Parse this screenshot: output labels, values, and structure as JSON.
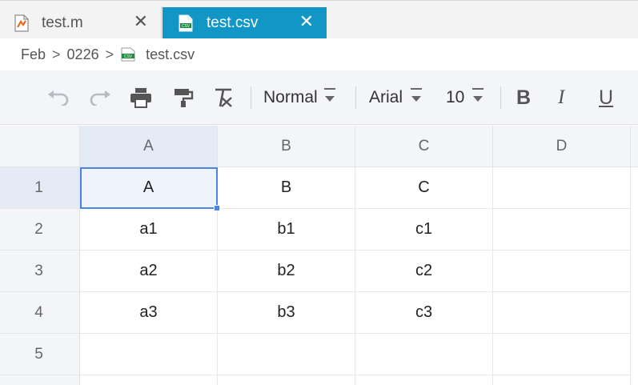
{
  "tabs": [
    {
      "label": "test.m",
      "icon": "matlab-file-icon",
      "active": false
    },
    {
      "label": "test.csv",
      "icon": "csv-file-icon",
      "active": true
    }
  ],
  "tab_close_glyph": "✕",
  "breadcrumb": {
    "items": [
      "Feb",
      "0226",
      "test.csv"
    ],
    "separator": ">"
  },
  "toolbar": {
    "style_dropdown": "Normal",
    "font_dropdown": "Arial",
    "size_dropdown": "10",
    "bold": "B",
    "italic": "I",
    "underline": "U",
    "icons": [
      "undo-icon",
      "redo-icon",
      "print-icon",
      "format-painter-icon",
      "clear-format-icon"
    ]
  },
  "sheet": {
    "columns": [
      "A",
      "B",
      "C",
      "D"
    ],
    "rows": [
      "1",
      "2",
      "3",
      "4",
      "5"
    ],
    "cells": [
      [
        "A",
        "B",
        "C",
        ""
      ],
      [
        "a1",
        "b1",
        "c1",
        ""
      ],
      [
        "a2",
        "b2",
        "c2",
        ""
      ],
      [
        "a3",
        "b3",
        "c3",
        ""
      ],
      [
        "",
        "",
        "",
        ""
      ]
    ],
    "active_cell": "A1"
  },
  "colors": {
    "active_tab": "#1196c6",
    "selection": "#4a84e4",
    "header_bg": "#f3f5f8"
  }
}
